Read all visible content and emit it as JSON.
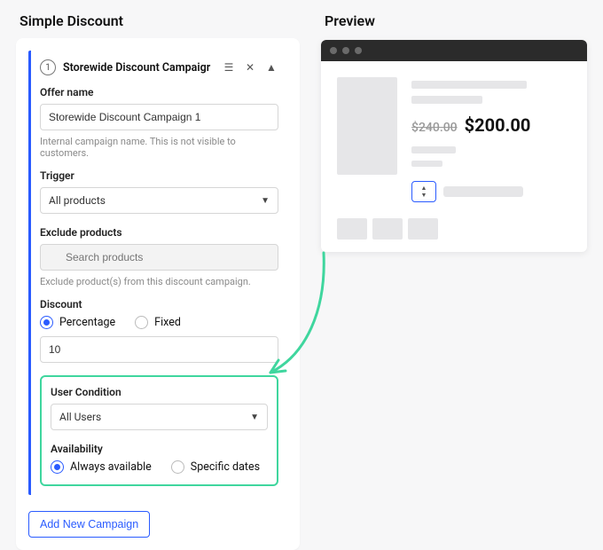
{
  "left": {
    "section_title": "Simple Discount",
    "campaign": {
      "index": "1",
      "header_title": "Storewide Discount Campaigr",
      "offer_name_label": "Offer name",
      "offer_name_value": "Storewide Discount Campaign 1",
      "offer_name_helper": "Internal campaign name. This is not visible to customers.",
      "trigger_label": "Trigger",
      "trigger_value": "All products",
      "exclude_label": "Exclude products",
      "exclude_placeholder": "Search products",
      "exclude_helper": "Exclude product(s) from this discount campaign.",
      "discount_label": "Discount",
      "discount_options": {
        "percentage": "Percentage",
        "fixed": "Fixed"
      },
      "discount_value": "10",
      "user_condition_label": "User Condition",
      "user_condition_value": "All Users",
      "availability_label": "Availability",
      "availability_options": {
        "always": "Always available",
        "specific": "Specific dates"
      }
    },
    "add_button": "Add New Campaign"
  },
  "right": {
    "section_title": "Preview",
    "prices": {
      "old": "$240.00",
      "new": "$200.00"
    }
  }
}
